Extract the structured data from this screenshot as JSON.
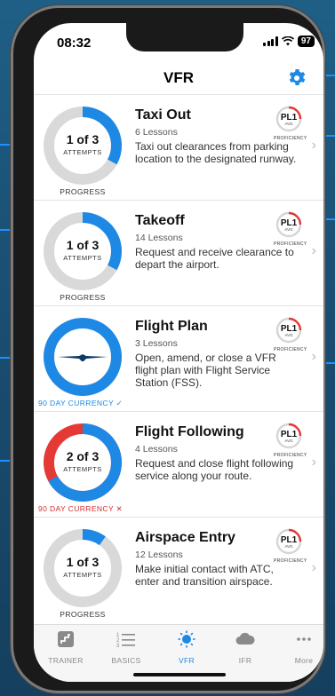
{
  "status": {
    "time": "08:32",
    "battery": "97"
  },
  "nav": {
    "title": "VFR"
  },
  "colors": {
    "accent": "#1e88e5",
    "ring_track": "#d9d9d9",
    "danger": "#e53935"
  },
  "proficiency_badge": {
    "top": "PL1",
    "mid": "AVG",
    "bottom": "PROFICIENCY"
  },
  "items": [
    {
      "title": "Taxi Out",
      "lessons": "6 Lessons",
      "description": "Taxi out clearances from parking location to the designated runway.",
      "count": "1 of 3",
      "count_sub": "ATTEMPTS",
      "caption": "PROGRESS",
      "progress": 0.33
    },
    {
      "title": "Takeoff",
      "lessons": "14 Lessons",
      "description": "Request and receive clearance to depart the airport.",
      "count": "1 of 3",
      "count_sub": "ATTEMPTS",
      "caption": "PROGRESS",
      "progress": 0.33
    },
    {
      "title": "Flight Plan",
      "lessons": "3 Lessons",
      "description": "Open, amend, or close a VFR flight plan with Flight Service Station (FSS).",
      "caption": "90 DAY CURRENCY ✓",
      "progress": 1.0
    },
    {
      "title": "Flight Following",
      "lessons": "4 Lessons",
      "description": "Request and close flight following service along your route.",
      "count": "2 of 3",
      "count_sub": "ATTEMPTS",
      "caption": "90 DAY CURRENCY ✕",
      "progress": 0.67
    },
    {
      "title": "Airspace Entry",
      "lessons": "12 Lessons",
      "description": "Make initial contact with ATC, enter and transition airspace.",
      "count": "1 of 3",
      "count_sub": "ATTEMPTS",
      "caption": "PROGRESS",
      "progress": 0.1
    }
  ],
  "tabs": [
    {
      "label": "TRAINER",
      "icon": "trainer-icon"
    },
    {
      "label": "BASICS",
      "icon": "list-icon"
    },
    {
      "label": "VFR",
      "icon": "sun-icon",
      "active": true
    },
    {
      "label": "IFR",
      "icon": "cloud-icon"
    },
    {
      "label": "More",
      "icon": "ellipsis-icon"
    }
  ]
}
